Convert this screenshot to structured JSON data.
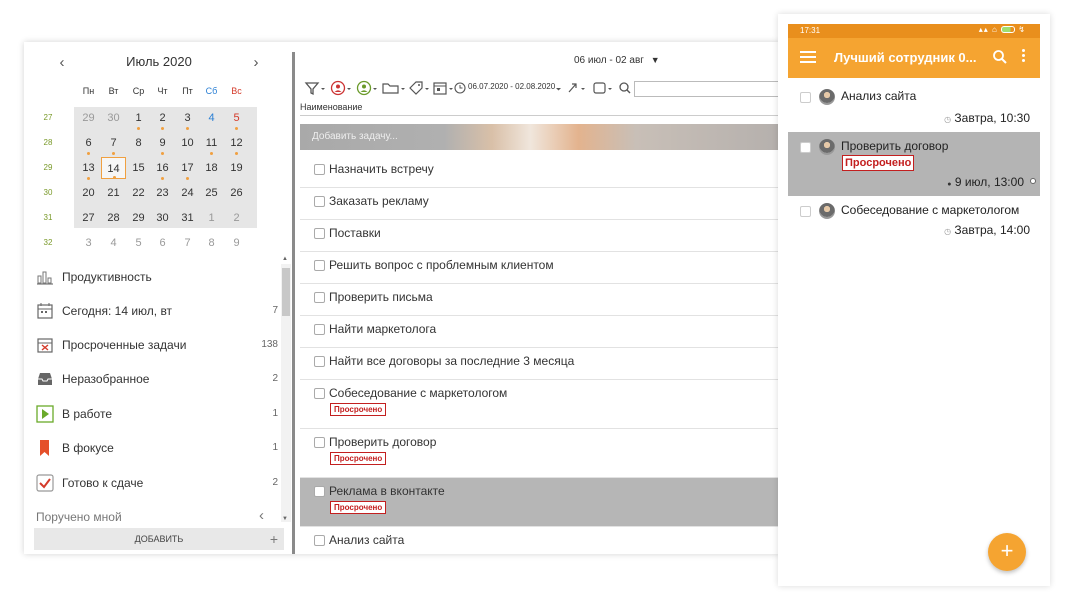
{
  "calendar": {
    "month_label": "Июль 2020",
    "prev_icon": "chevron-left-icon",
    "next_icon": "chevron-right-icon",
    "weekdays": [
      "Пн",
      "Вт",
      "Ср",
      "Чт",
      "Пт",
      "Сб",
      "Вс"
    ],
    "weekday_colors": [
      "#333333",
      "#333333",
      "#333333",
      "#333333",
      "#333333",
      "#2a7fd4",
      "#d43a2a"
    ],
    "weeks": [
      {
        "num": "27",
        "days": [
          "29",
          "30",
          "1",
          "2",
          "3",
          "4",
          "5"
        ]
      },
      {
        "num": "28",
        "days": [
          "6",
          "7",
          "8",
          "9",
          "10",
          "11",
          "12"
        ]
      },
      {
        "num": "29",
        "days": [
          "13",
          "14",
          "15",
          "16",
          "17",
          "18",
          "19"
        ]
      },
      {
        "num": "30",
        "days": [
          "20",
          "21",
          "22",
          "23",
          "24",
          "25",
          "26"
        ]
      },
      {
        "num": "31",
        "days": [
          "27",
          "28",
          "29",
          "30",
          "31",
          "1",
          "2"
        ]
      },
      {
        "num": "32",
        "days": [
          "3",
          "4",
          "5",
          "6",
          "7",
          "8",
          "9"
        ]
      }
    ],
    "today": "14"
  },
  "menu": [
    {
      "label": "Продуктивность",
      "count": "",
      "icon": "chart-icon"
    },
    {
      "label": "Сегодня: 14 июл, вт",
      "count": "7",
      "icon": "calendar-icon"
    },
    {
      "label": "Просроченные задачи",
      "count": "138",
      "icon": "calendar-overdue-icon"
    },
    {
      "label": "Неразобранное",
      "count": "2",
      "icon": "inbox-icon"
    },
    {
      "label": "В работе",
      "count": "1",
      "icon": "play-icon"
    },
    {
      "label": "В фокусе",
      "count": "1",
      "icon": "bookmark-icon"
    },
    {
      "label": "Готово к сдаче",
      "count": "2",
      "icon": "check-icon"
    }
  ],
  "delegated_label": "Поручено мной",
  "add_label": "ДОБАВИТЬ",
  "add_icon": "plus-icon",
  "right": {
    "range_label": "06 июл - 02 авг",
    "toolbar_date_range": "06.07.2020 - 02.08.2020",
    "column_name": "Наименование",
    "add_task_placeholder": "Добавить задачу...",
    "overdue_label": "Просрочено",
    "tasks": [
      {
        "title": "Назначить встречу",
        "overdue": false
      },
      {
        "title": "Заказать рекламу",
        "overdue": false
      },
      {
        "title": "Поставки",
        "overdue": false
      },
      {
        "title": "Решить вопрос с проблемным клиентом",
        "overdue": false
      },
      {
        "title": "Проверить письма",
        "overdue": false
      },
      {
        "title": "Найти маркетолога",
        "overdue": false
      },
      {
        "title": "Найти все договоры за последние 3 месяца",
        "overdue": false
      },
      {
        "title": "Собеседование с маркетологом",
        "overdue": true
      },
      {
        "title": "Проверить договор",
        "overdue": true
      },
      {
        "title": "Реклама в вконтакте",
        "overdue": true
      },
      {
        "title": "Анализ сайта",
        "overdue": false
      }
    ]
  },
  "phone": {
    "time": "17:31",
    "title": "Лучший сотрудник 0...",
    "overdue_label": "Просрочено",
    "tasks": [
      {
        "title": "Анализ сайта",
        "due": "Завтра, 10:30"
      },
      {
        "title": "Проверить договор",
        "due": "9 июл, 13:00"
      },
      {
        "title": "Собеседование с маркетологом",
        "due": "Завтра, 14:00"
      }
    ],
    "fab_label": "+"
  },
  "colors": {
    "accent_orange": "#f5a431",
    "overdue_red": "#c31f1f",
    "week_green": "#7a9a2a"
  }
}
